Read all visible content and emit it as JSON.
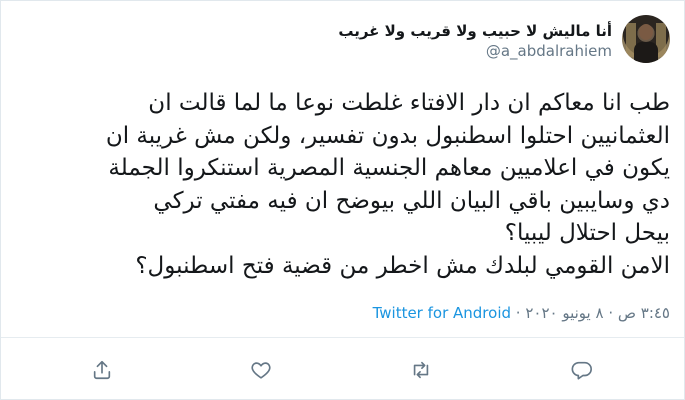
{
  "user": {
    "display_name": "أنا ماليش لا حبيب ولا قريب ولا غريب",
    "handle": "@a_abdalrahiem"
  },
  "tweet": {
    "lines": [
      "طب انا معاكم ان دار الافتاء غلطت نوعا ما لما قالت ان",
      "العثمانيين احتلوا اسطنبول بدون تفسير، ولكن مش غريبة ان",
      "يكون في اعلاميين معاهم الجنسية المصرية استنكروا الجملة",
      "دي وسايبين باقي البيان اللي بيوضح ان فيه مفتي تركي",
      "بيحل احتلال ليبيا؟",
      "الامن القومي لبلدك مش اخطر من قضية فتح اسطنبول؟"
    ]
  },
  "meta": {
    "time_date": "٣:٤٥ ص · ٨ يونيو ٢٠٢٠ · ",
    "source_app": "Twitter for Android"
  },
  "actions": [
    {
      "icon": "reply-icon"
    },
    {
      "icon": "retweet-icon"
    },
    {
      "icon": "like-icon"
    },
    {
      "icon": "share-icon"
    }
  ],
  "colors": {
    "text": "#14171a",
    "secondary": "#657786",
    "link": "#1b95e0",
    "border": "#e1e8ed"
  }
}
